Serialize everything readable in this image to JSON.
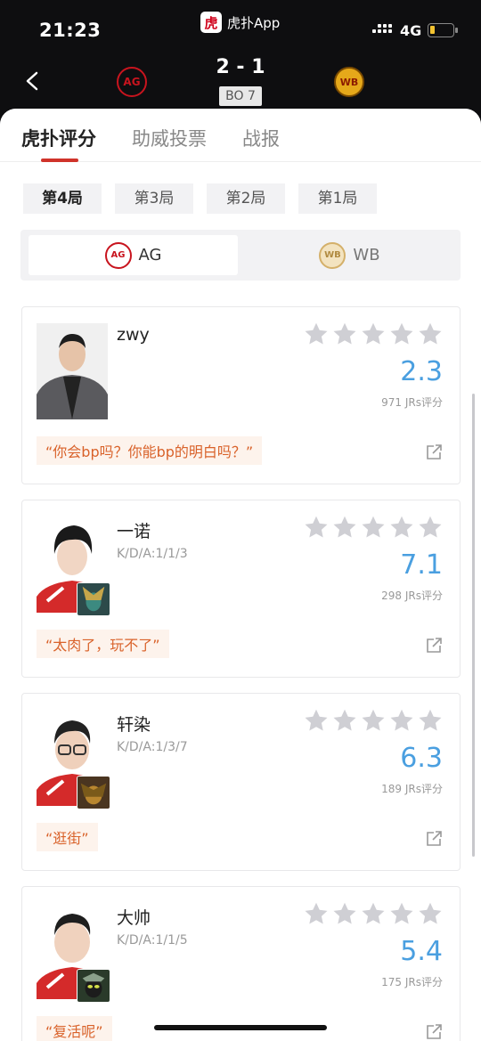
{
  "status_bar": {
    "time": "21:23",
    "app_logo_char": "虎",
    "app_name": "虎扑App",
    "network": "4G",
    "battery_level": 0.2
  },
  "match": {
    "score": "2 - 1",
    "format": "BO 7",
    "home_team_logo_text": "AG",
    "away_team_logo_text": "WB"
  },
  "tabs": [
    "虎扑评分",
    "助威投票",
    "战报"
  ],
  "game_tabs": [
    "第4局",
    "第3局",
    "第2局",
    "第1局"
  ],
  "team_switch": {
    "home": "AG",
    "away": "WB"
  },
  "players": [
    {
      "name": "zwy",
      "kda": "",
      "rating": "2.3",
      "votes": "971 JRs评分",
      "quote": "“你会bp吗？你能bp的明白吗？”"
    },
    {
      "name": "一诺",
      "kda": "K/D/A:1/1/3",
      "rating": "7.1",
      "votes": "298 JRs评分",
      "quote": "“太肉了，玩不了”"
    },
    {
      "name": "轩染",
      "kda": "K/D/A:1/3/7",
      "rating": "6.3",
      "votes": "189 JRs评分",
      "quote": "“逛街”"
    },
    {
      "name": "大帅",
      "kda": "K/D/A:1/1/5",
      "rating": "5.4",
      "votes": "175 JRs评分",
      "quote": "“复活呢”"
    }
  ],
  "colors": {
    "accent_red": "#d0332a",
    "rating_blue": "#4a9fe0",
    "quote_orange": "#d9622a"
  }
}
